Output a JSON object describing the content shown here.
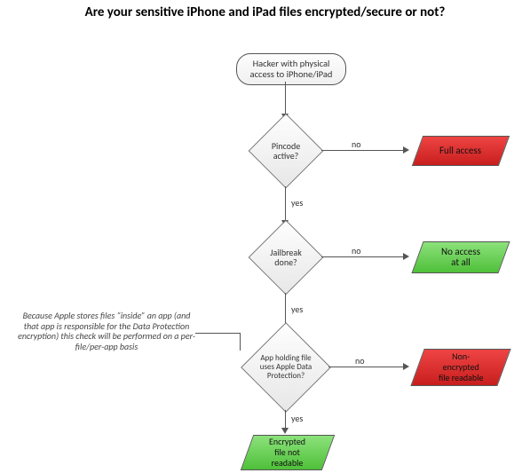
{
  "title": "Are your sensitive iPhone and iPad files encrypted/secure or not?",
  "start": {
    "label": "Hacker with physical\naccess to iPhone/iPad"
  },
  "decisions": {
    "pincode": {
      "label": "Pincode active?"
    },
    "jailbreak": {
      "label": "Jailbreak\ndone?"
    },
    "dataprot": {
      "label": "App holding file\nuses Apple Data\nProtection?"
    }
  },
  "outcomes": {
    "full_access": {
      "label": "Full access",
      "color": "red"
    },
    "no_access": {
      "label": "No access\nat all",
      "color": "green"
    },
    "non_encrypted": {
      "label": "Non-\nencrypted\nfile readable",
      "color": "red"
    },
    "encrypted": {
      "label": "Encrypted\nfile not\nreadable",
      "color": "green"
    }
  },
  "edges": {
    "yes": "yes",
    "no": "no"
  },
  "annotation": "Because Apple stores files “inside” an app\n(and that app is responsible for the Data\nProtection encryption) this check will be\nperformed on a per-file/per-app basis"
}
